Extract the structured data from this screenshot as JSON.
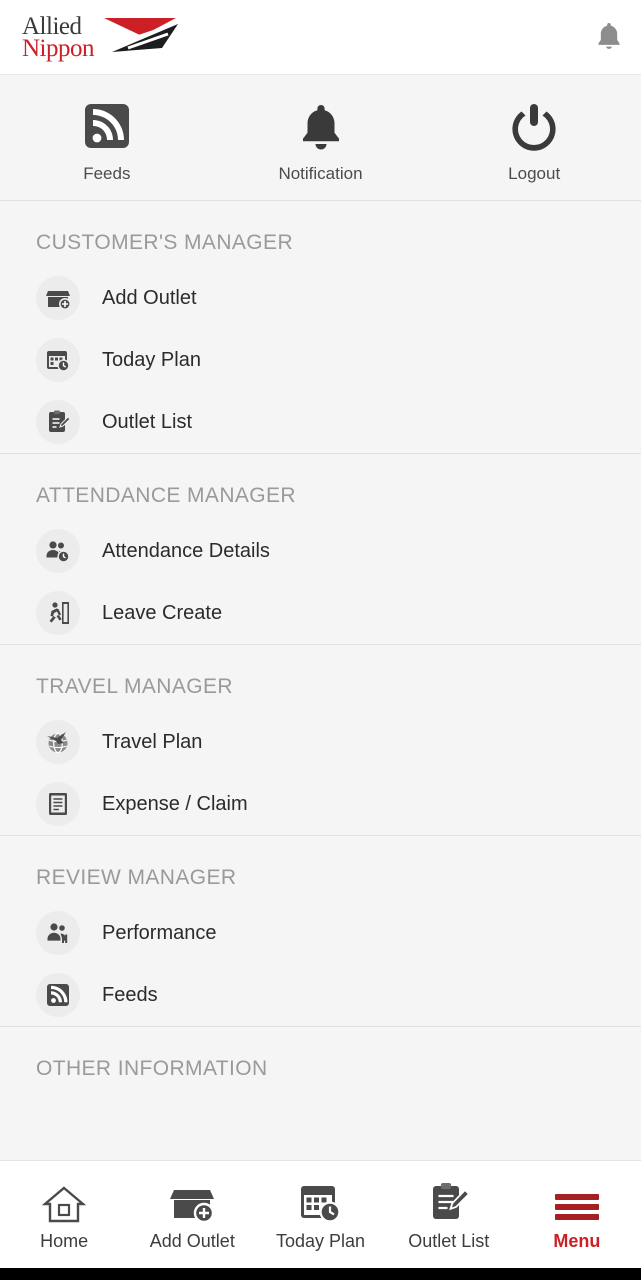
{
  "brand": {
    "name_line1": "Allied",
    "name_line2": "Nippon",
    "color_dark": "#3a3a3a",
    "color_red": "#cc2026"
  },
  "topbar": {
    "notification_icon": "bell-icon"
  },
  "quick_actions": [
    {
      "label": "Feeds",
      "icon": "rss-feed-icon"
    },
    {
      "label": "Notification",
      "icon": "bell-icon"
    },
    {
      "label": "Logout",
      "icon": "power-icon"
    }
  ],
  "sections": [
    {
      "title": "CUSTOMER'S MANAGER",
      "items": [
        {
          "label": "Add Outlet",
          "icon": "store-add-icon"
        },
        {
          "label": "Today Plan",
          "icon": "calendar-clock-icon"
        },
        {
          "label": "Outlet List",
          "icon": "clipboard-edit-icon"
        }
      ]
    },
    {
      "title": "ATTENDANCE MANAGER",
      "items": [
        {
          "label": "Attendance Details",
          "icon": "people-clock-icon"
        },
        {
          "label": "Leave Create",
          "icon": "running-exit-icon"
        }
      ]
    },
    {
      "title": "TRAVEL MANAGER",
      "items": [
        {
          "label": "Travel Plan",
          "icon": "travel-globe-icon"
        },
        {
          "label": "Expense / Claim",
          "icon": "receipt-icon"
        }
      ]
    },
    {
      "title": "REVIEW MANAGER",
      "items": [
        {
          "label": "Performance",
          "icon": "people-chart-icon"
        },
        {
          "label": "Feeds",
          "icon": "rss-feed-icon"
        }
      ]
    },
    {
      "title": "OTHER INFORMATION",
      "items": []
    }
  ],
  "bottom_nav": {
    "active": "Menu",
    "items": [
      {
        "label": "Home",
        "icon": "home-icon"
      },
      {
        "label": "Add Outlet",
        "icon": "store-add-icon"
      },
      {
        "label": "Today Plan",
        "icon": "calendar-clock-icon"
      },
      {
        "label": "Outlet List",
        "icon": "clipboard-edit-icon"
      },
      {
        "label": "Menu",
        "icon": "hamburger-icon"
      }
    ]
  }
}
